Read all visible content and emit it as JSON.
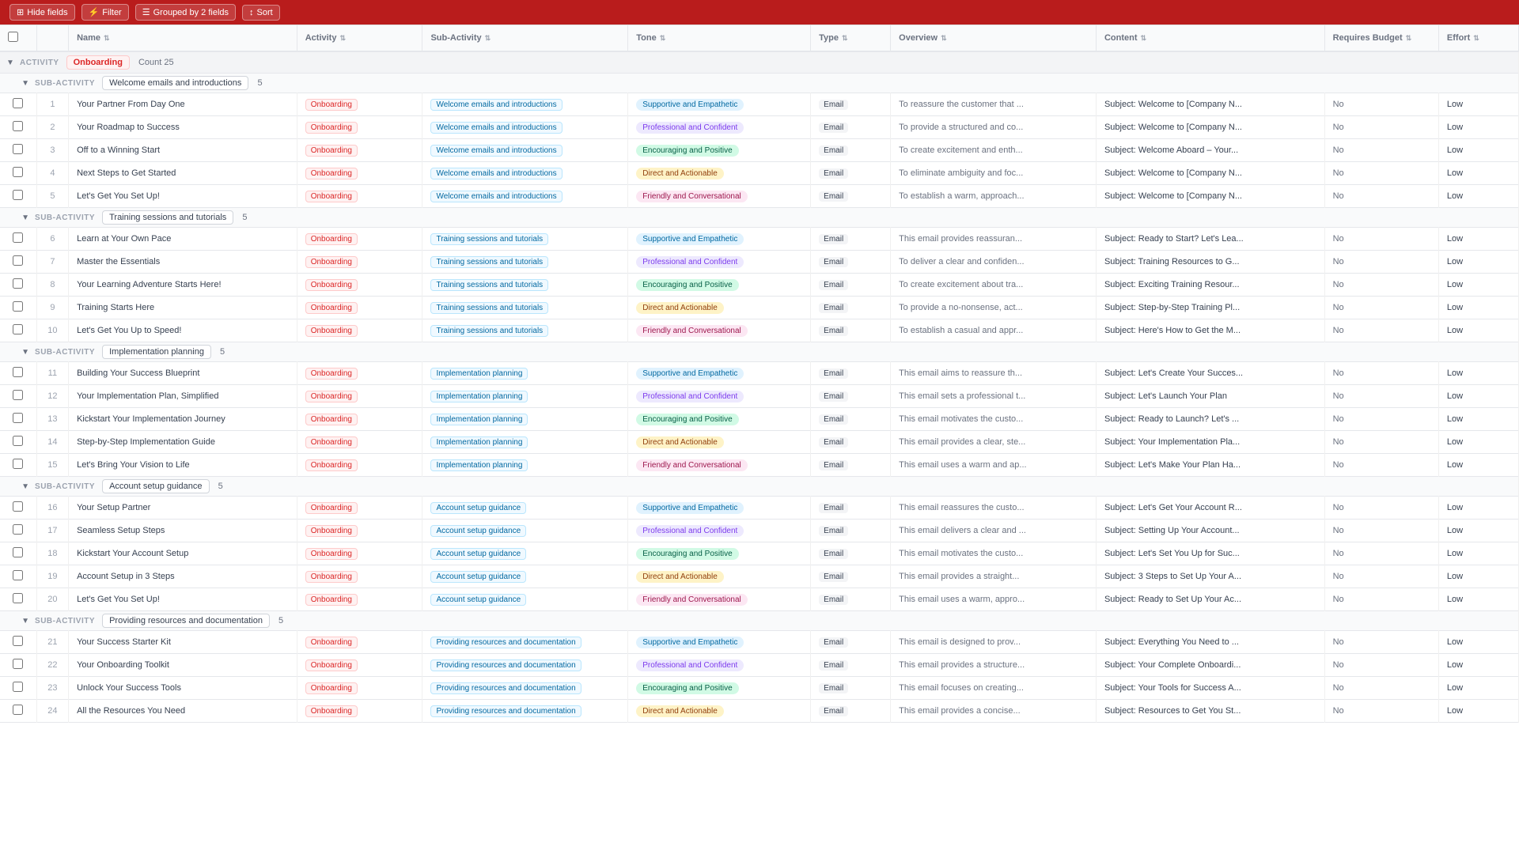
{
  "toolbar": {
    "hideFields": "Hide fields",
    "filter": "Filter",
    "groupedBy": "Grouped by 2 fields",
    "sort": "Sort"
  },
  "columns": [
    {
      "id": "check",
      "label": ""
    },
    {
      "id": "num",
      "label": ""
    },
    {
      "id": "name",
      "label": "Name"
    },
    {
      "id": "activity",
      "label": "Activity"
    },
    {
      "id": "subactivity",
      "label": "Sub-Activity"
    },
    {
      "id": "tone",
      "label": "Tone"
    },
    {
      "id": "type",
      "label": "Type"
    },
    {
      "id": "overview",
      "label": "Overview"
    },
    {
      "id": "content",
      "label": "Content"
    },
    {
      "id": "budget",
      "label": "Requires Budget"
    },
    {
      "id": "effort",
      "label": "Effort"
    }
  ],
  "activityGroup": {
    "label": "ACTIVITY",
    "name": "Onboarding",
    "count": 25
  },
  "subgroups": [
    {
      "label": "SUB-ACTIVITY",
      "name": "Welcome emails and introductions",
      "count": 5,
      "rows": [
        {
          "num": 1,
          "name": "Your Partner From Day One",
          "activity": "Onboarding",
          "subactivity": "Welcome emails and introductions",
          "tone": "Supportive and Empathetic",
          "toneClass": "tone-supportive",
          "type": "Email",
          "overview": "To reassure the customer that ...",
          "content": "Subject: Welcome to [Company N...",
          "budget": "No",
          "effort": "Low"
        },
        {
          "num": 2,
          "name": "Your Roadmap to Success",
          "activity": "Onboarding",
          "subactivity": "Welcome emails and introductions",
          "tone": "Professional and Confident",
          "toneClass": "tone-professional",
          "type": "Email",
          "overview": "To provide a structured and co...",
          "content": "Subject: Welcome to [Company N...",
          "budget": "No",
          "effort": "Low"
        },
        {
          "num": 3,
          "name": "Off to a Winning Start",
          "activity": "Onboarding",
          "subactivity": "Welcome emails and introductions",
          "tone": "Encouraging and Positive",
          "toneClass": "tone-encouraging",
          "type": "Email",
          "overview": "To create excitement and enth...",
          "content": "Subject: Welcome Aboard – Your...",
          "budget": "No",
          "effort": "Low"
        },
        {
          "num": 4,
          "name": "Next Steps to Get Started",
          "activity": "Onboarding",
          "subactivity": "Welcome emails and introductions",
          "tone": "Direct and Actionable",
          "toneClass": "tone-direct",
          "type": "Email",
          "overview": "To eliminate ambiguity and foc...",
          "content": "Subject: Welcome to [Company N...",
          "budget": "No",
          "effort": "Low"
        },
        {
          "num": 5,
          "name": "Let's Get You Set Up!",
          "activity": "Onboarding",
          "subactivity": "Welcome emails and introductions",
          "tone": "Friendly and Conversational",
          "toneClass": "tone-friendly",
          "type": "Email",
          "overview": "To establish a warm, approach...",
          "content": "Subject: Welcome to [Company N...",
          "budget": "No",
          "effort": "Low"
        }
      ]
    },
    {
      "label": "SUB-ACTIVITY",
      "name": "Training sessions and tutorials",
      "count": 5,
      "rows": [
        {
          "num": 6,
          "name": "Learn at Your Own Pace",
          "activity": "Onboarding",
          "subactivity": "Training sessions and tutorials",
          "tone": "Supportive and Empathetic",
          "toneClass": "tone-supportive",
          "type": "Email",
          "overview": "This email provides reassuran...",
          "content": "Subject: Ready to Start? Let's Lea...",
          "budget": "No",
          "effort": "Low"
        },
        {
          "num": 7,
          "name": "Master the Essentials",
          "activity": "Onboarding",
          "subactivity": "Training sessions and tutorials",
          "tone": "Professional and Confident",
          "toneClass": "tone-professional",
          "type": "Email",
          "overview": "To deliver a clear and confiden...",
          "content": "Subject: Training Resources to G...",
          "budget": "No",
          "effort": "Low"
        },
        {
          "num": 8,
          "name": "Your Learning Adventure Starts Here!",
          "activity": "Onboarding",
          "subactivity": "Training sessions and tutorials",
          "tone": "Encouraging and Positive",
          "toneClass": "tone-encouraging",
          "type": "Email",
          "overview": "To create excitement about tra...",
          "content": "Subject: Exciting Training Resour...",
          "budget": "No",
          "effort": "Low"
        },
        {
          "num": 9,
          "name": "Training Starts Here",
          "activity": "Onboarding",
          "subactivity": "Training sessions and tutorials",
          "tone": "Direct and Actionable",
          "toneClass": "tone-direct",
          "type": "Email",
          "overview": "To provide a no-nonsense, act...",
          "content": "Subject: Step-by-Step Training Pl...",
          "budget": "No",
          "effort": "Low"
        },
        {
          "num": 10,
          "name": "Let's Get You Up to Speed!",
          "activity": "Onboarding",
          "subactivity": "Training sessions and tutorials",
          "tone": "Friendly and Conversational",
          "toneClass": "tone-friendly",
          "type": "Email",
          "overview": "To establish a casual and appr...",
          "content": "Subject: Here's How to Get the M...",
          "budget": "No",
          "effort": "Low"
        }
      ]
    },
    {
      "label": "SUB-ACTIVITY",
      "name": "Implementation planning",
      "count": 5,
      "rows": [
        {
          "num": 11,
          "name": "Building Your Success Blueprint",
          "activity": "Onboarding",
          "subactivity": "Implementation planning",
          "tone": "Supportive and Empathetic",
          "toneClass": "tone-supportive",
          "type": "Email",
          "overview": "This email aims to reassure th...",
          "content": "Subject: Let's Create Your Succes...",
          "budget": "No",
          "effort": "Low"
        },
        {
          "num": 12,
          "name": "Your Implementation Plan, Simplified",
          "activity": "Onboarding",
          "subactivity": "Implementation planning",
          "tone": "Professional and Confident",
          "toneClass": "tone-professional",
          "type": "Email",
          "overview": "This email sets a professional t...",
          "content": "Subject: Let's Launch Your Plan",
          "budget": "No",
          "effort": "Low"
        },
        {
          "num": 13,
          "name": "Kickstart Your Implementation Journey",
          "activity": "Onboarding",
          "subactivity": "Implementation planning",
          "tone": "Encouraging and Positive",
          "toneClass": "tone-encouraging",
          "type": "Email",
          "overview": "This email motivates the custo...",
          "content": "Subject: Ready to Launch? Let's ...",
          "budget": "No",
          "effort": "Low"
        },
        {
          "num": 14,
          "name": "Step-by-Step Implementation Guide",
          "activity": "Onboarding",
          "subactivity": "Implementation planning",
          "tone": "Direct and Actionable",
          "toneClass": "tone-direct",
          "type": "Email",
          "overview": "This email provides a clear, ste...",
          "content": "Subject: Your Implementation Pla...",
          "budget": "No",
          "effort": "Low"
        },
        {
          "num": 15,
          "name": "Let's Bring Your Vision to Life",
          "activity": "Onboarding",
          "subactivity": "Implementation planning",
          "tone": "Friendly and Conversational",
          "toneClass": "tone-friendly",
          "type": "Email",
          "overview": "This email uses a warm and ap...",
          "content": "Subject: Let's Make Your Plan Ha...",
          "budget": "No",
          "effort": "Low"
        }
      ]
    },
    {
      "label": "SUB-ACTIVITY",
      "name": "Account setup guidance",
      "count": 5,
      "rows": [
        {
          "num": 16,
          "name": "Your Setup Partner",
          "activity": "Onboarding",
          "subactivity": "Account setup guidance",
          "tone": "Supportive and Empathetic",
          "toneClass": "tone-supportive",
          "type": "Email",
          "overview": "This email reassures the custo...",
          "content": "Subject: Let's Get Your Account R...",
          "budget": "No",
          "effort": "Low"
        },
        {
          "num": 17,
          "name": "Seamless Setup Steps",
          "activity": "Onboarding",
          "subactivity": "Account setup guidance",
          "tone": "Professional and Confident",
          "toneClass": "tone-professional",
          "type": "Email",
          "overview": "This email delivers a clear and ...",
          "content": "Subject: Setting Up Your Account...",
          "budget": "No",
          "effort": "Low"
        },
        {
          "num": 18,
          "name": "Kickstart Your Account Setup",
          "activity": "Onboarding",
          "subactivity": "Account setup guidance",
          "tone": "Encouraging and Positive",
          "toneClass": "tone-encouraging",
          "type": "Email",
          "overview": "This email motivates the custo...",
          "content": "Subject: Let's Set You Up for Suc...",
          "budget": "No",
          "effort": "Low"
        },
        {
          "num": 19,
          "name": "Account Setup in 3 Steps",
          "activity": "Onboarding",
          "subactivity": "Account setup guidance",
          "tone": "Direct and Actionable",
          "toneClass": "tone-direct",
          "type": "Email",
          "overview": "This email provides a straight...",
          "content": "Subject: 3 Steps to Set Up Your A...",
          "budget": "No",
          "effort": "Low"
        },
        {
          "num": 20,
          "name": "Let's Get You Set Up!",
          "activity": "Onboarding",
          "subactivity": "Account setup guidance",
          "tone": "Friendly and Conversational",
          "toneClass": "tone-friendly",
          "type": "Email",
          "overview": "This email uses a warm, appro...",
          "content": "Subject: Ready to Set Up Your Ac...",
          "budget": "No",
          "effort": "Low"
        }
      ]
    },
    {
      "label": "SUB-ACTIVITY",
      "name": "Providing resources and documentation",
      "count": 5,
      "rows": [
        {
          "num": 21,
          "name": "Your Success Starter Kit",
          "activity": "Onboarding",
          "subactivity": "Providing resources and documentation",
          "tone": "Supportive and Empathetic",
          "toneClass": "tone-supportive",
          "type": "Email",
          "overview": "This email is designed to prov...",
          "content": "Subject: Everything You Need to ...",
          "budget": "No",
          "effort": "Low"
        },
        {
          "num": 22,
          "name": "Your Onboarding Toolkit",
          "activity": "Onboarding",
          "subactivity": "Providing resources and documentation",
          "tone": "Professional and Confident",
          "toneClass": "tone-professional",
          "type": "Email",
          "overview": "This email provides a structure...",
          "content": "Subject: Your Complete Onboardi...",
          "budget": "No",
          "effort": "Low"
        },
        {
          "num": 23,
          "name": "Unlock Your Success Tools",
          "activity": "Onboarding",
          "subactivity": "Providing resources and documentation",
          "tone": "Encouraging and Positive",
          "toneClass": "tone-encouraging",
          "type": "Email",
          "overview": "This email focuses on creating...",
          "content": "Subject: Your Tools for Success A...",
          "budget": "No",
          "effort": "Low"
        },
        {
          "num": 24,
          "name": "All the Resources You Need",
          "activity": "Onboarding",
          "subactivity": "Providing resources and documentation",
          "tone": "Direct and Actionable",
          "toneClass": "tone-direct",
          "type": "Email",
          "overview": "This email provides a concise...",
          "content": "Subject: Resources to Get You St...",
          "budget": "No",
          "effort": "Low"
        }
      ]
    }
  ]
}
